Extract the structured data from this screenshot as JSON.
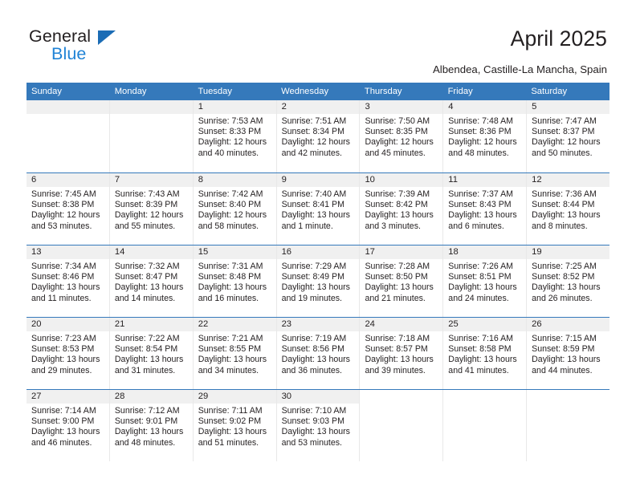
{
  "logo": {
    "word_one": "General",
    "word_two": "Blue",
    "triangle_color": "#1b6cb5",
    "blue_color": "#2083d6"
  },
  "header": {
    "title": "April 2025",
    "location": "Albendea, Castille-La Mancha, Spain"
  },
  "theme": {
    "header_blue": "#3579bb",
    "daynum_gray": "#f0f0f0",
    "cell_divider": "#e8e8e8",
    "text": "#231f20"
  },
  "calendar": {
    "weekday_headers": [
      "Sunday",
      "Monday",
      "Tuesday",
      "Wednesday",
      "Thursday",
      "Friday",
      "Saturday"
    ],
    "labels": {
      "sunrise": "Sunrise:",
      "sunset": "Sunset:",
      "daylight": "Daylight:"
    },
    "weeks": [
      [
        {
          "day": "",
          "sunrise": "",
          "sunset": "",
          "daylight": "",
          "empty": true
        },
        {
          "day": "",
          "sunrise": "",
          "sunset": "",
          "daylight": "",
          "empty": true
        },
        {
          "day": "1",
          "sunrise": "Sunrise: 7:53 AM",
          "sunset": "Sunset: 8:33 PM",
          "daylight": "Daylight: 12 hours and 40 minutes."
        },
        {
          "day": "2",
          "sunrise": "Sunrise: 7:51 AM",
          "sunset": "Sunset: 8:34 PM",
          "daylight": "Daylight: 12 hours and 42 minutes."
        },
        {
          "day": "3",
          "sunrise": "Sunrise: 7:50 AM",
          "sunset": "Sunset: 8:35 PM",
          "daylight": "Daylight: 12 hours and 45 minutes."
        },
        {
          "day": "4",
          "sunrise": "Sunrise: 7:48 AM",
          "sunset": "Sunset: 8:36 PM",
          "daylight": "Daylight: 12 hours and 48 minutes."
        },
        {
          "day": "5",
          "sunrise": "Sunrise: 7:47 AM",
          "sunset": "Sunset: 8:37 PM",
          "daylight": "Daylight: 12 hours and 50 minutes."
        }
      ],
      [
        {
          "day": "6",
          "sunrise": "Sunrise: 7:45 AM",
          "sunset": "Sunset: 8:38 PM",
          "daylight": "Daylight: 12 hours and 53 minutes."
        },
        {
          "day": "7",
          "sunrise": "Sunrise: 7:43 AM",
          "sunset": "Sunset: 8:39 PM",
          "daylight": "Daylight: 12 hours and 55 minutes."
        },
        {
          "day": "8",
          "sunrise": "Sunrise: 7:42 AM",
          "sunset": "Sunset: 8:40 PM",
          "daylight": "Daylight: 12 hours and 58 minutes."
        },
        {
          "day": "9",
          "sunrise": "Sunrise: 7:40 AM",
          "sunset": "Sunset: 8:41 PM",
          "daylight": "Daylight: 13 hours and 1 minute."
        },
        {
          "day": "10",
          "sunrise": "Sunrise: 7:39 AM",
          "sunset": "Sunset: 8:42 PM",
          "daylight": "Daylight: 13 hours and 3 minutes."
        },
        {
          "day": "11",
          "sunrise": "Sunrise: 7:37 AM",
          "sunset": "Sunset: 8:43 PM",
          "daylight": "Daylight: 13 hours and 6 minutes."
        },
        {
          "day": "12",
          "sunrise": "Sunrise: 7:36 AM",
          "sunset": "Sunset: 8:44 PM",
          "daylight": "Daylight: 13 hours and 8 minutes."
        }
      ],
      [
        {
          "day": "13",
          "sunrise": "Sunrise: 7:34 AM",
          "sunset": "Sunset: 8:46 PM",
          "daylight": "Daylight: 13 hours and 11 minutes."
        },
        {
          "day": "14",
          "sunrise": "Sunrise: 7:32 AM",
          "sunset": "Sunset: 8:47 PM",
          "daylight": "Daylight: 13 hours and 14 minutes."
        },
        {
          "day": "15",
          "sunrise": "Sunrise: 7:31 AM",
          "sunset": "Sunset: 8:48 PM",
          "daylight": "Daylight: 13 hours and 16 minutes."
        },
        {
          "day": "16",
          "sunrise": "Sunrise: 7:29 AM",
          "sunset": "Sunset: 8:49 PM",
          "daylight": "Daylight: 13 hours and 19 minutes."
        },
        {
          "day": "17",
          "sunrise": "Sunrise: 7:28 AM",
          "sunset": "Sunset: 8:50 PM",
          "daylight": "Daylight: 13 hours and 21 minutes."
        },
        {
          "day": "18",
          "sunrise": "Sunrise: 7:26 AM",
          "sunset": "Sunset: 8:51 PM",
          "daylight": "Daylight: 13 hours and 24 minutes."
        },
        {
          "day": "19",
          "sunrise": "Sunrise: 7:25 AM",
          "sunset": "Sunset: 8:52 PM",
          "daylight": "Daylight: 13 hours and 26 minutes."
        }
      ],
      [
        {
          "day": "20",
          "sunrise": "Sunrise: 7:23 AM",
          "sunset": "Sunset: 8:53 PM",
          "daylight": "Daylight: 13 hours and 29 minutes."
        },
        {
          "day": "21",
          "sunrise": "Sunrise: 7:22 AM",
          "sunset": "Sunset: 8:54 PM",
          "daylight": "Daylight: 13 hours and 31 minutes."
        },
        {
          "day": "22",
          "sunrise": "Sunrise: 7:21 AM",
          "sunset": "Sunset: 8:55 PM",
          "daylight": "Daylight: 13 hours and 34 minutes."
        },
        {
          "day": "23",
          "sunrise": "Sunrise: 7:19 AM",
          "sunset": "Sunset: 8:56 PM",
          "daylight": "Daylight: 13 hours and 36 minutes."
        },
        {
          "day": "24",
          "sunrise": "Sunrise: 7:18 AM",
          "sunset": "Sunset: 8:57 PM",
          "daylight": "Daylight: 13 hours and 39 minutes."
        },
        {
          "day": "25",
          "sunrise": "Sunrise: 7:16 AM",
          "sunset": "Sunset: 8:58 PM",
          "daylight": "Daylight: 13 hours and 41 minutes."
        },
        {
          "day": "26",
          "sunrise": "Sunrise: 7:15 AM",
          "sunset": "Sunset: 8:59 PM",
          "daylight": "Daylight: 13 hours and 44 minutes."
        }
      ],
      [
        {
          "day": "27",
          "sunrise": "Sunrise: 7:14 AM",
          "sunset": "Sunset: 9:00 PM",
          "daylight": "Daylight: 13 hours and 46 minutes."
        },
        {
          "day": "28",
          "sunrise": "Sunrise: 7:12 AM",
          "sunset": "Sunset: 9:01 PM",
          "daylight": "Daylight: 13 hours and 48 minutes."
        },
        {
          "day": "29",
          "sunrise": "Sunrise: 7:11 AM",
          "sunset": "Sunset: 9:02 PM",
          "daylight": "Daylight: 13 hours and 51 minutes."
        },
        {
          "day": "30",
          "sunrise": "Sunrise: 7:10 AM",
          "sunset": "Sunset: 9:03 PM",
          "daylight": "Daylight: 13 hours and 53 minutes."
        },
        {
          "day": "",
          "sunrise": "",
          "sunset": "",
          "daylight": "",
          "blank": true
        },
        {
          "day": "",
          "sunrise": "",
          "sunset": "",
          "daylight": "",
          "blank": true
        },
        {
          "day": "",
          "sunrise": "",
          "sunset": "",
          "daylight": "",
          "blank": true
        }
      ]
    ]
  }
}
